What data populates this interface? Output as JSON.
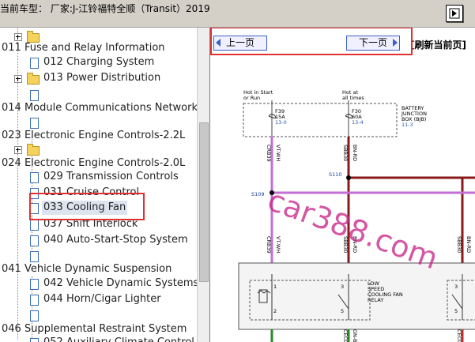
{
  "window": {
    "title": "当前车型：  厂家:J-江铃福特全顺（Transit）2019"
  },
  "tree": {
    "items": [
      {
        "text": "011 Fuse and Relay Information"
      },
      {
        "text": "012 Charging System"
      },
      {
        "text": "013 Power Distribution"
      },
      {
        "text": "014 Module Communications Network"
      },
      {
        "text": "023 Electronic Engine Controls-2.2L"
      },
      {
        "text": "024 Electronic Engine Controls-2.0L"
      },
      {
        "text": "029 Transmission Controls"
      },
      {
        "text": "031 Cruise Control"
      },
      {
        "text": "033 Cooling Fan"
      },
      {
        "text": "037 Shift Interlock"
      },
      {
        "text": "040 Auto-Start-Stop System"
      },
      {
        "text": "041 Vehicle Dynamic Suspension"
      },
      {
        "text": "042 Vehicle Dynamic Systems"
      },
      {
        "text": "044 Horn/Cigar Lighter"
      },
      {
        "text": "046 Supplemental Restraint System"
      },
      {
        "text": "052 Auxiliary Climate Control"
      }
    ]
  },
  "nav": {
    "prev": "上一页",
    "next": "下一页",
    "refresh": "刷新当前页"
  },
  "diagram": {
    "hot_start": "Hot in Start",
    "hot_start2": "or Run",
    "hot_all": "Hot at",
    "hot_all2": "all times",
    "bjb1": "BATTERY",
    "bjb2": "JUNCTION",
    "bjb3": "BOX (BJB)",
    "bjb4": "11-3",
    "f39": "F39",
    "f39a": "15A",
    "f39p": "13-0",
    "f30": "F30",
    "f30a": "60A",
    "f30p": "13-4",
    "w1a": "CRB39",
    "w1b": "VT-WH",
    "w2a": "SBB30",
    "w2b": "BN-RD",
    "s110": "S110",
    "s109": "S109",
    "w3a": "CRB39",
    "w3b": "VT-WH",
    "w4a": "SBB30",
    "w4b": "BN-RD",
    "w5a": "SBB30",
    "w5b": "BN-RD",
    "relay1": "LOW",
    "relay2": "SPEED",
    "relay3": "COOLING FAN",
    "relay4": "RELAY",
    "p1": "1",
    "p2": "2",
    "p3": "3",
    "p5": "5",
    "p3b": "3",
    "p5b": "5",
    "w6a": "CEC09",
    "w6b": "GN-BU",
    "w7": "CEC07"
  },
  "watermark": "car388.com"
}
